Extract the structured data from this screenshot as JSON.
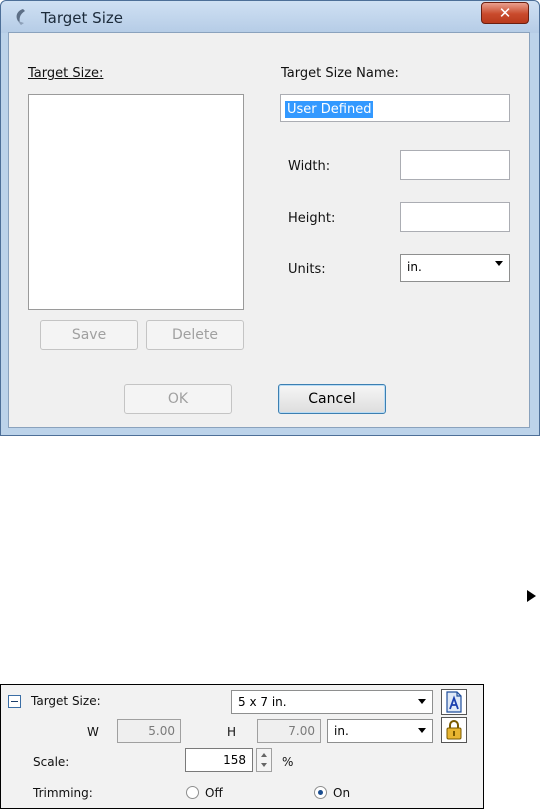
{
  "dialog": {
    "title": "Target Size",
    "close_glyph": "✕",
    "target_size_label": "Target Size:",
    "target_size_name_label": "Target Size Name:",
    "target_size_name_value": "User Defined",
    "width_label": "Width:",
    "width_value": "",
    "height_label": "Height:",
    "height_value": "",
    "units_label": "Units:",
    "units_value": "in.",
    "save_label": "Save",
    "delete_label": "Delete",
    "ok_label": "OK",
    "cancel_label": "Cancel"
  },
  "panel": {
    "target_size_label": "Target Size:",
    "target_size_value": "5 x 7 in.",
    "w_label": "W",
    "w_value": "5.00",
    "h_label": "H",
    "h_value": "7.00",
    "units_value": "in.",
    "scale_label": "Scale:",
    "scale_value": "158",
    "scale_unit": "%",
    "trimming_label": "Trimming:",
    "trimming_off_label": "Off",
    "trimming_on_label": "On",
    "trimming_selected": "On"
  },
  "icons": {
    "orientation": "portrait-orientation-icon",
    "lock": "lock-icon",
    "arrow": "right-arrow-icon"
  }
}
